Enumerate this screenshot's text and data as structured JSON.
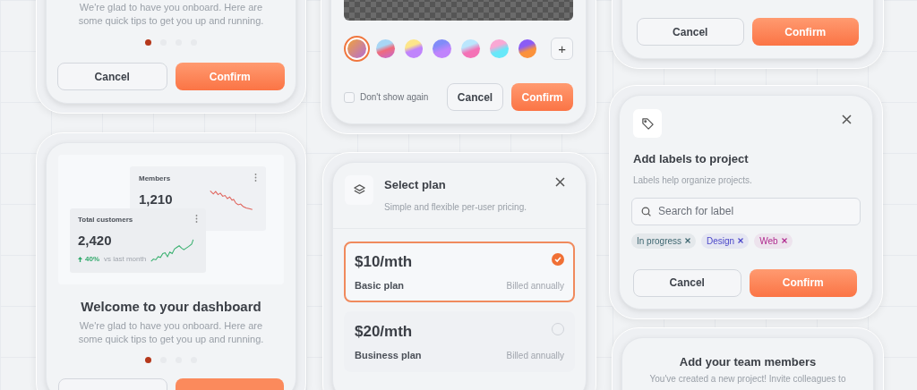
{
  "onboarding_top": {
    "description": "We're glad to have you onboard. Here are some quick tips to get you up and running.",
    "steps": [
      {
        "selected": true
      },
      {
        "selected": false
      },
      {
        "selected": false
      },
      {
        "selected": false
      }
    ],
    "buttons": [
      "Cancel",
      "Confirm"
    ]
  },
  "color_picker": {
    "swatches": [
      {
        "selected": true
      },
      {
        "selected": false
      },
      {
        "selected": false
      },
      {
        "selected": false
      },
      {
        "selected": false
      },
      {
        "selected": false
      },
      {
        "selected": false
      }
    ],
    "add_label": "+",
    "dont_show_again": {
      "label": "Don't show again",
      "checked": false
    },
    "buttons": [
      "Cancel",
      "Confirm"
    ]
  },
  "confirm_top_right": {
    "buttons": [
      "Cancel",
      "Confirm"
    ]
  },
  "dashboard_welcome": {
    "members": {
      "title": "Members",
      "value": "1,210"
    },
    "total_customers": {
      "title": "Total customers",
      "value": "2,420",
      "change": "40%",
      "change_note": "vs last month"
    },
    "title": "Welcome to your dashboard",
    "description": "We're glad to have you onboard. Here are some quick tips to get you up and running.",
    "steps": [
      {
        "selected": true
      },
      {
        "selected": false
      },
      {
        "selected": false
      },
      {
        "selected": false
      }
    ]
  },
  "select_plan": {
    "title": "Select plan",
    "subtitle": "Simple and flexible per-user pricing.",
    "plans": [
      {
        "price": "$10/mth",
        "name": "Basic plan",
        "billing": "Billed annually",
        "selected": true
      },
      {
        "price": "$20/mth",
        "name": "Business plan",
        "billing": "Billed annually",
        "selected": false
      }
    ]
  },
  "add_labels": {
    "title": "Add labels to project",
    "subtitle": "Labels help organize projects.",
    "search": {
      "placeholder": "Search for label"
    },
    "tags": [
      {
        "label": "In progress",
        "color": "#3d6670"
      },
      {
        "label": "Design",
        "color": "#4b47c9"
      },
      {
        "label": "Web",
        "color": "#b02a8f"
      }
    ],
    "buttons": [
      "Cancel",
      "Confirm"
    ]
  },
  "team_members": {
    "title": "Add your team members",
    "description": "You've created a new project! Invite colleagues to"
  }
}
